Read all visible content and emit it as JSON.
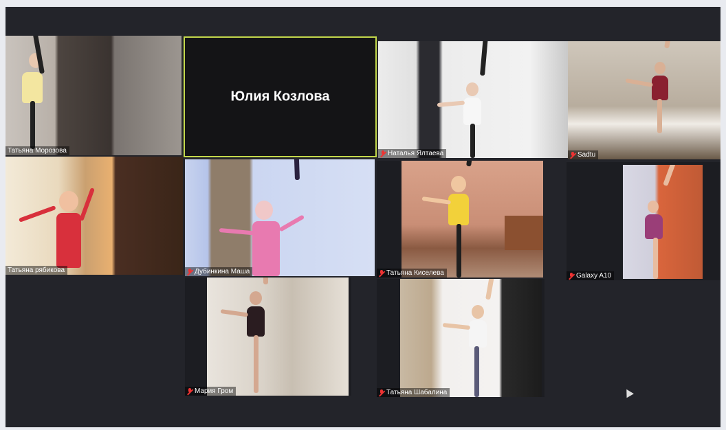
{
  "meeting": {
    "participants": [
      {
        "name": "Татьяна Морозова",
        "muted": false
      },
      {
        "name": "Юлия Козлова",
        "muted": false,
        "video_off": true,
        "active_speaker": true
      },
      {
        "name": "Наталья Ялтаева",
        "muted": true
      },
      {
        "name": "Sadtu",
        "muted": true
      },
      {
        "name": "Татьяна рябикова",
        "muted": false
      },
      {
        "name": "Дубинкина Маша",
        "muted": true
      },
      {
        "name": "Татьяна Киселева",
        "muted": true
      },
      {
        "name": "Galaxy A10",
        "muted": true
      },
      {
        "name": "Мария Гром",
        "muted": true
      },
      {
        "name": "Татьяна Шабалина",
        "muted": true
      }
    ]
  },
  "colors": {
    "active_border": "#c3d84b",
    "muted_icon": "#ee3333",
    "background": "#23242a"
  },
  "icons": [
    "microphone-muted-icon",
    "mouse-cursor-icon"
  ]
}
